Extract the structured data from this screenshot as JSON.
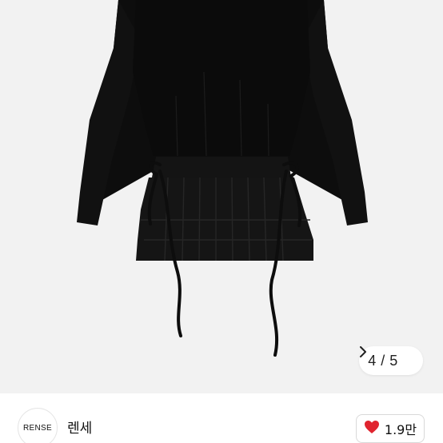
{
  "product_image": {
    "pager": {
      "current": "4",
      "separator": "/",
      "total": "5",
      "text": "4 / 5",
      "chevron_icon": "chevron-right-icon"
    },
    "background_color": "#f2f2f2",
    "garment_color": "#0d0d0d"
  },
  "seller": {
    "avatar_text": "RENSE",
    "name": "렌세"
  },
  "like": {
    "icon": "heart-icon",
    "icon_color": "#e0242f",
    "count": "1.9만"
  }
}
